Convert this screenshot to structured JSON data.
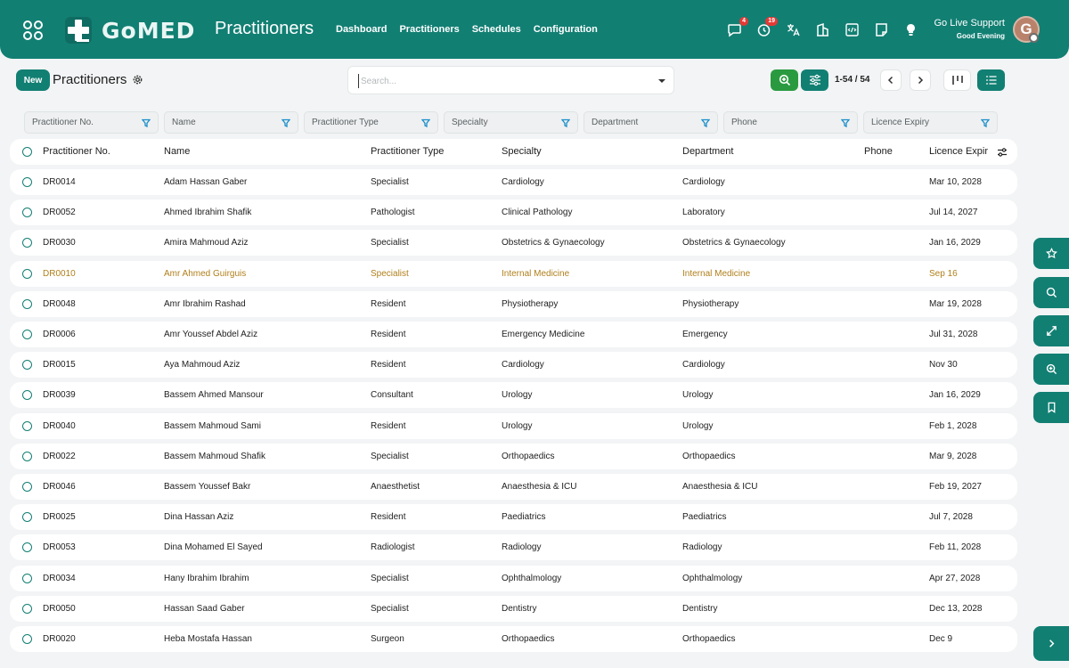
{
  "header": {
    "logo_text": "GoMED",
    "page_title": "Practitioners",
    "nav": [
      "Dashboard",
      "Practitioners",
      "Schedules",
      "Configuration"
    ],
    "icons": [
      {
        "name": "chat-icon",
        "badge": "4"
      },
      {
        "name": "clock-icon",
        "badge": "19"
      },
      {
        "name": "translate-icon",
        "badge": ""
      },
      {
        "name": "building-icon",
        "badge": ""
      },
      {
        "name": "code-icon",
        "badge": ""
      },
      {
        "name": "note-icon",
        "badge": ""
      },
      {
        "name": "bulb-icon",
        "badge": ""
      }
    ],
    "support_title": "Go Live Support",
    "greeting": "Good Evening",
    "avatar_initial": "G"
  },
  "toolbar": {
    "new_label": "New",
    "title": "Practitioners",
    "search_placeholder": "Search...",
    "pager": "1-54 / 54"
  },
  "filters": [
    "Practitioner No.",
    "Name",
    "Practitioner Type",
    "Specialty",
    "Department",
    "Phone",
    "Licence Expiry"
  ],
  "table": {
    "columns": {
      "no": "Practitioner No.",
      "name": "Name",
      "type": "Practitioner Type",
      "specialty": "Specialty",
      "department": "Department",
      "phone": "Phone",
      "expiry": "Licence Expir"
    },
    "rows": [
      {
        "no": "DR0014",
        "name": "Adam Hassan Gaber",
        "type": "Specialist",
        "specialty": "Cardiology",
        "department": "Cardiology",
        "phone": "",
        "expiry": "Mar 10, 2028",
        "highlight": false
      },
      {
        "no": "DR0052",
        "name": "Ahmed Ibrahim Shafik",
        "type": "Pathologist",
        "specialty": "Clinical Pathology",
        "department": "Laboratory",
        "phone": "",
        "expiry": "Jul 14, 2027",
        "highlight": false
      },
      {
        "no": "DR0030",
        "name": "Amira Mahmoud Aziz",
        "type": "Specialist",
        "specialty": "Obstetrics & Gynaecology",
        "department": "Obstetrics & Gynaecology",
        "phone": "",
        "expiry": "Jan 16, 2029",
        "highlight": false
      },
      {
        "no": "DR0010",
        "name": "Amr Ahmed Guirguis",
        "type": "Specialist",
        "specialty": "Internal Medicine",
        "department": "Internal Medicine",
        "phone": "",
        "expiry": "Sep 16",
        "highlight": true
      },
      {
        "no": "DR0048",
        "name": "Amr Ibrahim Rashad",
        "type": "Resident",
        "specialty": "Physiotherapy",
        "department": "Physiotherapy",
        "phone": "",
        "expiry": "Mar 19, 2028",
        "highlight": false
      },
      {
        "no": "DR0006",
        "name": "Amr Youssef Abdel Aziz",
        "type": "Resident",
        "specialty": "Emergency Medicine",
        "department": "Emergency",
        "phone": "",
        "expiry": "Jul 31, 2028",
        "highlight": false
      },
      {
        "no": "DR0015",
        "name": "Aya Mahmoud Aziz",
        "type": "Resident",
        "specialty": "Cardiology",
        "department": "Cardiology",
        "phone": "",
        "expiry": "Nov 30",
        "highlight": false
      },
      {
        "no": "DR0039",
        "name": "Bassem Ahmed Mansour",
        "type": "Consultant",
        "specialty": "Urology",
        "department": "Urology",
        "phone": "",
        "expiry": "Jan 16, 2029",
        "highlight": false
      },
      {
        "no": "DR0040",
        "name": "Bassem Mahmoud Sami",
        "type": "Resident",
        "specialty": "Urology",
        "department": "Urology",
        "phone": "",
        "expiry": "Feb 1, 2028",
        "highlight": false
      },
      {
        "no": "DR0022",
        "name": "Bassem Mahmoud Shafik",
        "type": "Specialist",
        "specialty": "Orthopaedics",
        "department": "Orthopaedics",
        "phone": "",
        "expiry": "Mar 9, 2028",
        "highlight": false
      },
      {
        "no": "DR0046",
        "name": "Bassem Youssef Bakr",
        "type": "Anaesthetist",
        "specialty": "Anaesthesia & ICU",
        "department": "Anaesthesia & ICU",
        "phone": "",
        "expiry": "Feb 19, 2027",
        "highlight": false
      },
      {
        "no": "DR0025",
        "name": "Dina Hassan Aziz",
        "type": "Resident",
        "specialty": "Paediatrics",
        "department": "Paediatrics",
        "phone": "",
        "expiry": "Jul 7, 2028",
        "highlight": false
      },
      {
        "no": "DR0053",
        "name": "Dina Mohamed El Sayed",
        "type": "Radiologist",
        "specialty": "Radiology",
        "department": "Radiology",
        "phone": "",
        "expiry": "Feb 11, 2028",
        "highlight": false
      },
      {
        "no": "DR0034",
        "name": "Hany Ibrahim Ibrahim",
        "type": "Specialist",
        "specialty": "Ophthalmology",
        "department": "Ophthalmology",
        "phone": "",
        "expiry": "Apr 27, 2028",
        "highlight": false
      },
      {
        "no": "DR0050",
        "name": "Hassan Saad Gaber",
        "type": "Specialist",
        "specialty": "Dentistry",
        "department": "Dentistry",
        "phone": "",
        "expiry": "Dec 13, 2028",
        "highlight": false
      },
      {
        "no": "DR0020",
        "name": "Heba Mostafa Hassan",
        "type": "Surgeon",
        "specialty": "Orthopaedics",
        "department": "Orthopaedics",
        "phone": "",
        "expiry": "Dec 9",
        "highlight": false
      }
    ]
  },
  "side_tabs": [
    "star-icon",
    "search-icon",
    "expand-icon",
    "zoom-in-icon",
    "bookmark-icon"
  ],
  "colors": {
    "primary": "#127f73",
    "accent_green": "#2a9a40",
    "highlight_text": "#b07f1b",
    "badge": "#e53935"
  }
}
